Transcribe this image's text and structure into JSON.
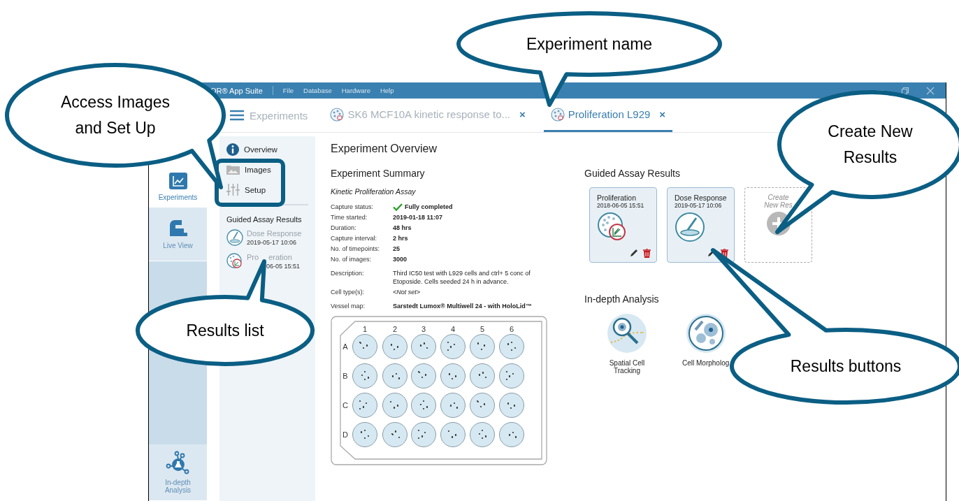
{
  "app": {
    "title": "OR® App Suite",
    "menu": [
      "File",
      "Database",
      "Hardware",
      "Help"
    ]
  },
  "tabs": [
    {
      "kind": "home",
      "label": "Experiments",
      "selected": false
    },
    {
      "kind": "experiment",
      "label": "SK6 MCF10A kinetic response to...",
      "close": "×",
      "selected": false
    },
    {
      "kind": "experiment",
      "label": "Proliferation L929",
      "close": "×",
      "selected": true
    }
  ],
  "nav": [
    {
      "kind": "chart",
      "label": "Experiments",
      "selected": true
    },
    {
      "kind": "microscope",
      "label": "Live View",
      "selected": false
    },
    {
      "kind": "network",
      "label": "In-depth Analysis",
      "selected": false
    }
  ],
  "side_menu": [
    {
      "kind": "info",
      "label": "Overview"
    },
    {
      "kind": "images",
      "label": "Images"
    },
    {
      "kind": "setup",
      "label": "Setup"
    }
  ],
  "side_results": {
    "heading": "Guided Assay Results",
    "items": [
      {
        "kind": "dose",
        "title_parts": [
          "Dose Response"
        ],
        "date": "2019-05-17 10:06"
      },
      {
        "kind": "proliferation",
        "title_parts": [
          "Pro",
          "eration"
        ],
        "date": "06-05 15:51"
      }
    ]
  },
  "overview": {
    "title": "Experiment Overview",
    "summary_heading": "Experiment Summary",
    "assay_type": "Kinetic Proliferation Assay",
    "field_groups": [
      [
        {
          "label": "Capture status:",
          "value": "Fully completed",
          "kind": "status"
        },
        {
          "label": "Time started:",
          "value": "2019-01-18 11:07",
          "kind": "bold"
        },
        {
          "label": "Duration:",
          "value": "48 hrs",
          "kind": "bold"
        },
        {
          "label": "Capture interval:",
          "value": "2 hrs",
          "kind": "bold"
        },
        {
          "label": "No. of timepoints:",
          "value": "25",
          "kind": "bold"
        },
        {
          "label": "No. of images:",
          "value": "3000",
          "kind": "bold"
        }
      ],
      [
        {
          "label": "Description:",
          "value": "Third IC50 test with L929 cells and ctrl+ 5 conc of Etoposide. Cells seeded 24 h in advance.",
          "kind": "plain"
        },
        {
          "label": "Cell type(s):",
          "value": "<Not set>",
          "kind": "italic"
        }
      ],
      [
        {
          "label": "Vessel map:",
          "value": "Sarstedt Lumox® Multiwell 24 - with HoloLid™",
          "kind": "bold"
        }
      ]
    ],
    "plate": {
      "columns": [
        "1",
        "2",
        "3",
        "4",
        "5",
        "6"
      ],
      "rows": [
        "A",
        "B",
        "C",
        "D"
      ]
    }
  },
  "results": {
    "heading": "Guided Assay Results",
    "cards": [
      {
        "kind": "result",
        "title": "Proliferation",
        "date": "2018-06-05 15:51"
      },
      {
        "kind": "result",
        "title": "Dose Response",
        "date": "2019-05-17 10:06"
      },
      {
        "kind": "create",
        "lines": [
          "Create",
          "New Res"
        ]
      }
    ]
  },
  "analysis": {
    "heading": "In-depth Analysis",
    "items": [
      {
        "kind": "tracking",
        "label": "Spatial Cell Tracking"
      },
      {
        "kind": "morphology",
        "label": "Cell Morpholog"
      }
    ]
  },
  "callouts": [
    {
      "text": "Experiment name"
    },
    {
      "text": "Access Images and Set Up"
    },
    {
      "text": "Create New Results"
    },
    {
      "text": "Results list"
    },
    {
      "text": "Results buttons"
    }
  ]
}
